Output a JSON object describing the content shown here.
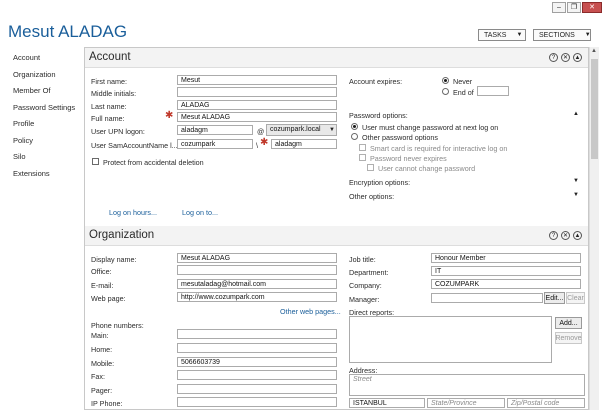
{
  "window": {
    "title": "Mesut ALADAG",
    "tasks_label": "TASKS",
    "sections_label": "SECTIONS"
  },
  "nav": [
    "Account",
    "Organization",
    "Member Of",
    "Password Settings",
    "Profile",
    "Policy",
    "Silo",
    "Extensions"
  ],
  "account": {
    "title": "Account",
    "first_name_label": "First name:",
    "first_name": "Mesut",
    "middle_label": "Middle initials:",
    "middle": "",
    "last_name_label": "Last name:",
    "last_name": "ALADAG",
    "full_name_label": "Full name:",
    "full_name": "Mesut ALADAG",
    "upn_label": "User UPN logon:",
    "upn": "aladagm",
    "at": "@",
    "domain": "cozumpark.local",
    "sam_label": "User SamAccountName l...",
    "sam_domain": "cozumpark",
    "sam_sep": "\\",
    "sam": "aladagm",
    "protect_label": "Protect from accidental deletion",
    "logon_hours": "Log on hours...",
    "logon_to": "Log on to...",
    "expires_label": "Account expires:",
    "never": "Never",
    "end_of": "End of",
    "pw_options": "Password options:",
    "pw_must_change": "User must change password at next log on",
    "pw_other": "Other password options",
    "smart_card": "Smart card is required for interactive log on",
    "pw_never_expires": "Password never expires",
    "cannot_change": "User cannot change password",
    "encryption": "Encryption options:",
    "other_options": "Other options:"
  },
  "organization": {
    "title": "Organization",
    "display_label": "Display name:",
    "display": "Mesut ALADAG",
    "office_label": "Office:",
    "office": "",
    "email_label": "E-mail:",
    "email": "mesutaladag@hotmail.com",
    "web_label": "Web page:",
    "web": "http://www.cozumpark.com",
    "other_web": "Other web pages...",
    "phones_label": "Phone numbers:",
    "main_label": "Main:",
    "main": "",
    "home_label": "Home:",
    "home": "",
    "mobile_label": "Mobile:",
    "mobile": "5066603739",
    "fax_label": "Fax:",
    "fax": "",
    "pager_label": "Pager:",
    "pager": "",
    "ip_label": "IP Phone:",
    "ip": "",
    "job_label": "Job title:",
    "job": "Honour Member",
    "dept_label": "Department:",
    "dept": "IT",
    "company_label": "Company:",
    "company": "COZUMPARK",
    "manager_label": "Manager:",
    "manager": "",
    "edit": "Edit...",
    "clear": "Clear",
    "direct_label": "Direct reports:",
    "add": "Add...",
    "remove": "Remove",
    "address_label": "Address:",
    "street_ph": "Street",
    "city": "ISTANBUL",
    "state_ph": "State/Province",
    "zip_ph": "Zip/Postal code"
  }
}
